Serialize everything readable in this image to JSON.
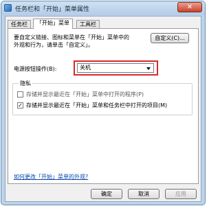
{
  "window": {
    "title": "任务栏和「开始」菜单属性",
    "close_symbol": "✕"
  },
  "tabs": [
    {
      "label": "任务栏"
    },
    {
      "label": "「开始」菜单"
    },
    {
      "label": "工具栏"
    }
  ],
  "main": {
    "description_line1": "要自定义链接、图标和菜单在「开始」菜单中的",
    "description_line2": "外观和行为，请单击「自定义」。",
    "customize_button": "自定义(C)...",
    "power_label": "电源按钮操作(B):",
    "power_selected": "关机",
    "privacy": {
      "title": "隐私",
      "item1": "存储并显示最近在「开始」菜单中打开的程序(P)",
      "item1_checked": "",
      "item2": "存储并显示最近在「开始」菜单和任务栏中打开的项目(M)",
      "item2_checked": "✓"
    },
    "help_link": "如何更改「开始」菜单的外观?"
  },
  "buttons": {
    "ok": "确定",
    "cancel": "取消",
    "apply": "应用"
  },
  "colors": {
    "highlight": "#d9272b",
    "link": "#0645ad"
  },
  "icons": {
    "app": "taskbar-properties-icon",
    "dropdown": "chevron-down-icon",
    "checkmark": "checkmark-icon"
  }
}
